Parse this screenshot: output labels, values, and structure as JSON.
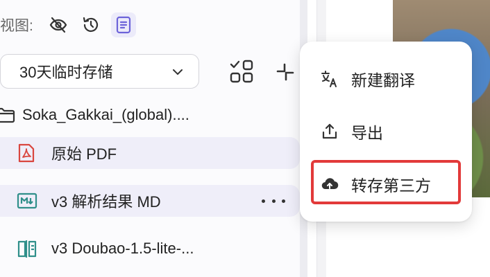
{
  "view": {
    "label": "视图:"
  },
  "storage_select": {
    "value": "30天临时存储"
  },
  "tree": {
    "folder": {
      "name": "Soka_Gakkai_(global)...."
    },
    "items": [
      {
        "label": "原始 PDF"
      },
      {
        "label": "v3 解析结果 MD"
      },
      {
        "label": "v3 Doubao-1.5-lite-..."
      }
    ]
  },
  "context_menu": {
    "items": [
      {
        "label": "新建翻译",
        "icon": "translate-icon"
      },
      {
        "label": "导出",
        "icon": "export-icon"
      },
      {
        "label": "转存第三方",
        "icon": "cloud-upload-icon"
      }
    ]
  },
  "colors": {
    "accent": "#6c63d9",
    "pdf_red": "#d9463f",
    "md_teal": "#2f8f8a",
    "highlight_red": "#e23a3a"
  }
}
